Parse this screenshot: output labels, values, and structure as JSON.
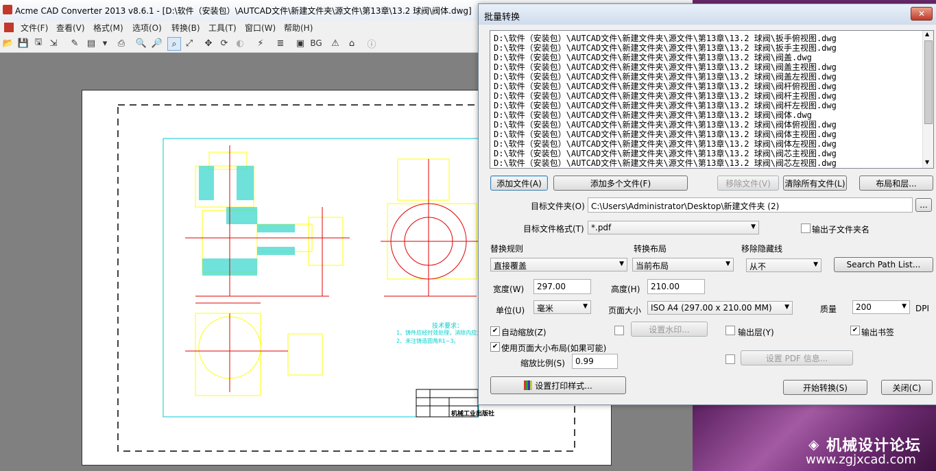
{
  "main_window": {
    "title": "Acme CAD Converter 2013 v8.6.1 - [D:\\软件（安装包）\\AUTCAD文件\\新建文件夹\\源文件\\第13章\\13.2  球阀\\阀体.dwg]",
    "menu": [
      "文件(F)",
      "查看(V)",
      "格式(M)",
      "选项(O)",
      "转换(B)",
      "工具(T)",
      "窗口(W)",
      "帮助(H)"
    ],
    "toolbar_bg_label": "BG",
    "drawing_texts": {
      "tech_title": "技术要求：",
      "tech_1": "1、铸件应经时效处理，消除内应力",
      "tech_2": "2、未注铸造圆角R1~3。",
      "publisher": "机械工业出版社"
    }
  },
  "dialog": {
    "title": "批量转换",
    "close_label": "✕",
    "files": [
      "D:\\软件（安装包）\\AUTCAD文件\\新建文件夹\\源文件\\第13章\\13.2  球阀\\扳手俯视图.dwg",
      "D:\\软件（安装包）\\AUTCAD文件\\新建文件夹\\源文件\\第13章\\13.2  球阀\\扳手主视图.dwg",
      "D:\\软件（安装包）\\AUTCAD文件\\新建文件夹\\源文件\\第13章\\13.2  球阀\\阀盖.dwg",
      "D:\\软件（安装包）\\AUTCAD文件\\新建文件夹\\源文件\\第13章\\13.2  球阀\\阀盖主视图.dwg",
      "D:\\软件（安装包）\\AUTCAD文件\\新建文件夹\\源文件\\第13章\\13.2  球阀\\阀盖左视图.dwg",
      "D:\\软件（安装包）\\AUTCAD文件\\新建文件夹\\源文件\\第13章\\13.2  球阀\\阀杆俯视图.dwg",
      "D:\\软件（安装包）\\AUTCAD文件\\新建文件夹\\源文件\\第13章\\13.2  球阀\\阀杆主视图.dwg",
      "D:\\软件（安装包）\\AUTCAD文件\\新建文件夹\\源文件\\第13章\\13.2  球阀\\阀杆左视图.dwg",
      "D:\\软件（安装包）\\AUTCAD文件\\新建文件夹\\源文件\\第13章\\13.2  球阀\\阀体.dwg",
      "D:\\软件（安装包）\\AUTCAD文件\\新建文件夹\\源文件\\第13章\\13.2  球阀\\阀体俯视图.dwg",
      "D:\\软件（安装包）\\AUTCAD文件\\新建文件夹\\源文件\\第13章\\13.2  球阀\\阀体主视图.dwg",
      "D:\\软件（安装包）\\AUTCAD文件\\新建文件夹\\源文件\\第13章\\13.2  球阀\\阀体左视图.dwg",
      "D:\\软件（安装包）\\AUTCAD文件\\新建文件夹\\源文件\\第13章\\13.2  球阀\\阀芯主视图.dwg",
      "D:\\软件（安装包）\\AUTCAD文件\\新建文件夹\\源文件\\第13章\\13.2  球阀\\阀芯左视图.dwg"
    ],
    "buttons": {
      "add_file": "添加文件(A)",
      "add_multi": "添加多个文件(F)",
      "remove_file": "移除文件(V)",
      "clear_all": "清除所有文件(L)",
      "layout_layers": "布局和层...",
      "browse": "...",
      "search_path": "Search Path List...",
      "watermark": "设置水印...",
      "pdf_info": "设置 PDF 信息...",
      "print_style": "设置打印样式...",
      "start": "开始转换(S)",
      "close": "关闭(C)"
    },
    "target_folder_label": "目标文件夹(O)",
    "target_folder_value": "C:\\Users\\Administrator\\Desktop\\新建文件夹 (2)",
    "target_format_label": "目标文件格式(T)",
    "target_format_value": "*.pdf",
    "output_subfolder_label": "输出子文件夹名",
    "replace_rule_label": "替换规则",
    "replace_rule_value": "直接覆盖",
    "convert_layout_label": "转换布局",
    "convert_layout_value": "当前布局",
    "remove_hidden_label": "移除隐藏线",
    "remove_hidden_value": "从不",
    "width_label": "宽度(W)",
    "width_value": "297.00",
    "height_label": "高度(H)",
    "height_value": "210.00",
    "unit_label": "单位(U)",
    "unit_value": "毫米",
    "page_size_label": "页面大小",
    "page_size_value": "ISO A4 (297.00 x 210.00 MM)",
    "quality_label": "质量",
    "quality_value": "200",
    "dpi_label": "DPI",
    "auto_zoom_label": "自动缩放(Z)",
    "output_layers_label": "输出层(Y)",
    "output_bookmarks_label": "输出书签",
    "use_page_layout_label": "使用页面大小布局(如果可能)",
    "zoom_ratio_label": "缩放比例(S)",
    "zoom_ratio_value": "0.99"
  },
  "watermark_logo": {
    "text_cn": "机械设计论坛",
    "url": "www.zgjxcad.com"
  }
}
